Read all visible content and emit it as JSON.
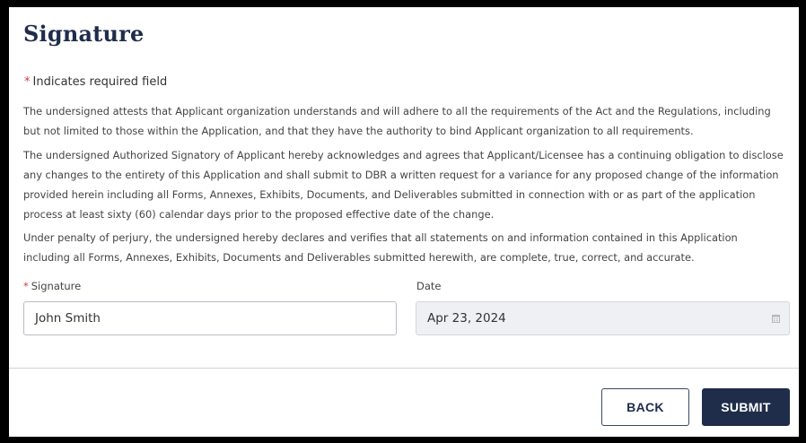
{
  "form": {
    "title": "Signature",
    "required_note": "Indicates required field",
    "required_marker": "*",
    "paragraphs": [
      "The undersigned attests that Applicant organization understands and will adhere to all the requirements of the Act and the Regulations, including but not limited to those within the Application, and that they have the authority to bind Applicant organization to all requirements.",
      "The undersigned Authorized Signatory of Applicant hereby acknowledges and agrees that Applicant/Licensee has a continuing obligation to disclose any changes to the entirety of this Application and shall submit to DBR a written request for a variance for any proposed change of the information provided herein including all Forms, Annexes, Exhibits, Documents, and Deliverables submitted in connection with or as part of the application process at least sixty (60) calendar days prior to the proposed effective date of the change.",
      "Under penalty of perjury, the undersigned hereby declares and verifies that all statements on and information contained in this Application including all Forms, Annexes, Exhibits, Documents and Deliverables submitted herewith, are complete, true, correct, and accurate."
    ],
    "signature": {
      "label": "Signature",
      "value": "John Smith"
    },
    "date": {
      "label": "Date",
      "value": "Apr 23, 2024",
      "icon": "calendar-icon"
    }
  },
  "actions": {
    "back_label": "BACK",
    "submit_label": "SUBMIT"
  },
  "colors": {
    "primary": "#1f2d4a",
    "required": "#d93636",
    "disabled_bg": "#eef0f3"
  }
}
